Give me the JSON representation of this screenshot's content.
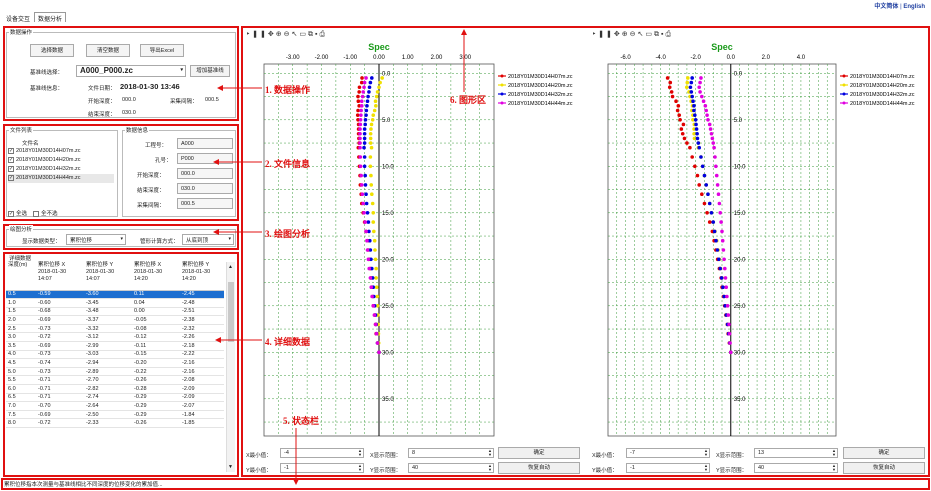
{
  "lang": {
    "zh": "中文简体",
    "sep": "|",
    "en": "English"
  },
  "tabs": [
    "设备交互",
    "数据分析"
  ],
  "data_ops": {
    "title": "数据操作",
    "btn_select": "选择数据",
    "btn_clear": "清空数据",
    "btn_export": "导出Excel",
    "baseline_label": "基准线选择：",
    "baseline_value": "A000_P000.zc",
    "btn_add_baseline": "增加基准线",
    "info_label": "基准线信息：",
    "file_date_label": "文件日期：",
    "file_date": "2018-01-30 13:46",
    "start_depth_label": "开始深度：",
    "start_depth": "000.0",
    "interval_label": "采集间隔：",
    "interval": "000.5",
    "end_depth_label": "结束深度：",
    "end_depth": "030.0"
  },
  "file_list": {
    "title": "文件列表",
    "header": "文件名",
    "files": [
      "2018Y01M30D14H07m.zc",
      "2018Y01M30D14H20m.zc",
      "2018Y01M30D14H32m.zc",
      "2018Y01M30D14H44m.zc"
    ],
    "select_all": "全选",
    "select_none": "全不选"
  },
  "data_info": {
    "title": "数据信息",
    "project_label": "工程号：",
    "project": "A000",
    "hole_label": "孔号：",
    "hole": "P000",
    "start_label": "开始深度：",
    "start": "000.0",
    "end_label": "结束深度：",
    "end": "030.0",
    "interval_label": "采集间隔：",
    "interval": "000.5"
  },
  "plot_analysis": {
    "title": "绘图分析",
    "display_label": "显示数据类型：",
    "display_value": "累积位移",
    "calc_label": "管形计算方式：",
    "calc_value": "从底到顶"
  },
  "detail": {
    "title": "详细数据",
    "headers": [
      "深度(m)",
      "累积位移 X\n2018-01-30\n14:07",
      "累积位移 Y\n2018-01-30\n14:07",
      "累积位移 X\n2018-01-30\n14:20",
      "累积位移 Y\n2018-01-30\n14:20"
    ],
    "rows": [
      [
        "0.5",
        "-0.59",
        "-3.60",
        "0.11",
        "-2.45"
      ],
      [
        "1.0",
        "-0.60",
        "-3.45",
        "0.04",
        "-2.48"
      ],
      [
        "1.5",
        "-0.68",
        "-3.48",
        "0.00",
        "-2.51"
      ],
      [
        "2.0",
        "-0.69",
        "-3.37",
        "-0.05",
        "-2.38"
      ],
      [
        "2.5",
        "-0.73",
        "-3.32",
        "-0.08",
        "-2.32"
      ],
      [
        "3.0",
        "-0.72",
        "-3.12",
        "-0.12",
        "-2.26"
      ],
      [
        "3.5",
        "-0.69",
        "-2.99",
        "-0.11",
        "-2.18"
      ],
      [
        "4.0",
        "-0.73",
        "-3.03",
        "-0.15",
        "-2.22"
      ],
      [
        "4.5",
        "-0.74",
        "-2.94",
        "-0.20",
        "-2.16"
      ],
      [
        "5.0",
        "-0.73",
        "-2.89",
        "-0.22",
        "-2.16"
      ],
      [
        "5.5",
        "-0.71",
        "-2.70",
        "-0.26",
        "-2.08"
      ],
      [
        "6.0",
        "-0.71",
        "-2.82",
        "-0.28",
        "-2.09"
      ],
      [
        "6.5",
        "-0.71",
        "-2.74",
        "-0.29",
        "-2.09"
      ],
      [
        "7.0",
        "-0.70",
        "-2.64",
        "-0.29",
        "-2.07"
      ],
      [
        "7.5",
        "-0.69",
        "-2.50",
        "-0.29",
        "-1.84"
      ],
      [
        "8.0",
        "-0.72",
        "-2.33",
        "-0.26",
        "-1.85"
      ]
    ]
  },
  "status": "累积位移指本次测量与基准线相比不同深度的位移变化的累加值...",
  "annotations": {
    "a1": "1. 数据操作",
    "a2": "2. 文件信息",
    "a3": "3. 绘图分析",
    "a4": "4. 详细数据",
    "a5": "5. 状态栏",
    "a6": "6. 图形区"
  },
  "controls_left": {
    "xmin_label": "X最小值：",
    "xmin": "-4",
    "xrange_label": "X显示范围：",
    "xrange": "8",
    "ymin_label": "Y最小值：",
    "ymin": "-1",
    "yrange_label": "Y显示范围：",
    "yrange": "40",
    "ok": "确定",
    "auto": "恢复自动"
  },
  "controls_right": {
    "xmin_label": "X最小值：",
    "xmin": "-7",
    "xrange_label": "X显示范围：",
    "xrange": "13",
    "ymin_label": "Y最小值：",
    "ymin": "-1",
    "yrange_label": "Y显示范围：",
    "yrange": "40",
    "ok": "确定",
    "auto": "恢复自动"
  },
  "toolbar_icons": [
    "pause-icon",
    "pan-icon",
    "zoom-in-icon",
    "zoom-out-icon",
    "cursor-icon",
    "select-icon",
    "copy-icon",
    "save-icon",
    "print-icon",
    "preview-icon"
  ],
  "chart_data": [
    {
      "type": "scatter",
      "title": "Spec",
      "xlim": [
        -4,
        4
      ],
      "ylim": [
        -1,
        39
      ],
      "y_inverted": true,
      "x_ticks": [
        -3,
        -2,
        -1,
        0,
        1,
        2,
        3
      ],
      "x_tick_labels": [
        "-3.00",
        "-2.00",
        "-1.00",
        "0.00",
        "1.00",
        "2.00",
        "3.00"
      ],
      "y_ticks": [
        0,
        5,
        10,
        15,
        20,
        25,
        30,
        35
      ],
      "y_tick_labels": [
        "0.0",
        "5.0",
        "10.0",
        "15.0",
        "20.0",
        "25.0",
        "30.0",
        "35.0"
      ],
      "grid": true,
      "legend": "right",
      "series": [
        {
          "name": "2018Y01M30D14H07m.zc",
          "color": "#e00000",
          "depth": [
            0.5,
            1,
            1.5,
            2,
            2.5,
            3,
            3.5,
            4,
            4.5,
            5,
            5.5,
            6,
            6.5,
            7,
            7.5,
            8,
            9,
            10,
            11,
            12,
            13,
            14,
            15,
            16,
            17,
            18,
            19,
            20,
            21,
            22,
            23,
            24,
            25,
            26,
            27,
            28,
            29,
            30
          ],
          "x": [
            -0.59,
            -0.6,
            -0.68,
            -0.69,
            -0.73,
            -0.72,
            -0.69,
            -0.73,
            -0.74,
            -0.73,
            -0.71,
            -0.71,
            -0.71,
            -0.7,
            -0.69,
            -0.72,
            -0.7,
            -0.68,
            -0.66,
            -0.65,
            -0.62,
            -0.6,
            -0.55,
            -0.5,
            -0.45,
            -0.4,
            -0.38,
            -0.35,
            -0.3,
            -0.28,
            -0.25,
            -0.22,
            -0.2,
            -0.15,
            -0.12,
            -0.1,
            -0.05,
            0
          ]
        },
        {
          "name": "2018Y01M30D14H20m.zc",
          "color": "#f0e000",
          "depth": [
            0.5,
            1,
            1.5,
            2,
            2.5,
            3,
            3.5,
            4,
            4.5,
            5,
            5.5,
            6,
            6.5,
            7,
            7.5,
            8,
            9,
            10,
            11,
            12,
            13,
            14,
            15,
            16,
            17,
            18,
            19,
            20,
            21,
            22,
            23,
            24,
            25,
            26,
            27,
            28,
            29,
            30
          ],
          "x": [
            0.11,
            0.04,
            0,
            -0.05,
            -0.08,
            -0.12,
            -0.11,
            -0.15,
            -0.2,
            -0.22,
            -0.26,
            -0.28,
            -0.29,
            -0.29,
            -0.29,
            -0.26,
            -0.3,
            -0.3,
            -0.28,
            -0.27,
            -0.25,
            -0.22,
            -0.2,
            -0.2,
            -0.18,
            -0.15,
            -0.14,
            -0.12,
            -0.1,
            -0.1,
            -0.08,
            -0.06,
            -0.05,
            -0.04,
            -0.03,
            -0.02,
            -0.01,
            0
          ]
        },
        {
          "name": "2018Y01M30D14H32m.zc",
          "color": "#0000e0",
          "depth": [
            0.5,
            1,
            1.5,
            2,
            2.5,
            3,
            3.5,
            4,
            4.5,
            5,
            5.5,
            6,
            6.5,
            7,
            7.5,
            8,
            9,
            10,
            11,
            12,
            13,
            14,
            15,
            16,
            17,
            18,
            19,
            20,
            21,
            22,
            23,
            24,
            25,
            26,
            27,
            28,
            29,
            30
          ],
          "x": [
            -0.25,
            -0.3,
            -0.33,
            -0.35,
            -0.38,
            -0.4,
            -0.42,
            -0.44,
            -0.45,
            -0.47,
            -0.48,
            -0.5,
            -0.5,
            -0.5,
            -0.5,
            -0.52,
            -0.5,
            -0.5,
            -0.48,
            -0.47,
            -0.45,
            -0.43,
            -0.4,
            -0.37,
            -0.35,
            -0.32,
            -0.3,
            -0.28,
            -0.25,
            -0.22,
            -0.2,
            -0.18,
            -0.15,
            -0.12,
            -0.1,
            -0.08,
            -0.05,
            0
          ]
        },
        {
          "name": "2018Y01M30D14H44m.zc",
          "color": "#e000e0",
          "depth": [
            0.5,
            1,
            1.5,
            2,
            2.5,
            3,
            3.5,
            4,
            4.5,
            5,
            5.5,
            6,
            6.5,
            7,
            7.5,
            8,
            9,
            10,
            11,
            12,
            13,
            14,
            15,
            16,
            17,
            18,
            19,
            20,
            21,
            22,
            23,
            24,
            25,
            26,
            27,
            28,
            29,
            30
          ],
          "x": [
            -0.45,
            -0.5,
            -0.52,
            -0.55,
            -0.57,
            -0.6,
            -0.6,
            -0.62,
            -0.63,
            -0.64,
            -0.65,
            -0.66,
            -0.66,
            -0.66,
            -0.66,
            -0.66,
            -0.65,
            -0.64,
            -0.62,
            -0.6,
            -0.58,
            -0.55,
            -0.52,
            -0.48,
            -0.45,
            -0.42,
            -0.4,
            -0.37,
            -0.34,
            -0.3,
            -0.27,
            -0.24,
            -0.2,
            -0.16,
            -0.12,
            -0.09,
            -0.05,
            0
          ]
        }
      ]
    },
    {
      "type": "scatter",
      "title": "Spec",
      "xlim": [
        -7,
        6
      ],
      "ylim": [
        -1,
        39
      ],
      "y_inverted": true,
      "x_ticks": [
        -6,
        -4,
        -2,
        0,
        2,
        4
      ],
      "x_tick_labels": [
        "-6.0",
        "-4.0",
        "-2.0",
        "0.0",
        "2.0",
        "4.0"
      ],
      "y_ticks": [
        0,
        5,
        10,
        15,
        20,
        25,
        30,
        35
      ],
      "y_tick_labels": [
        "0.0",
        "5.0",
        "10.0",
        "15.0",
        "20.0",
        "25.0",
        "30.0",
        "35.0"
      ],
      "grid": true,
      "legend": "right",
      "series": [
        {
          "name": "2018Y01M30D14H07m.zc",
          "color": "#e00000",
          "depth": [
            0.5,
            1,
            1.5,
            2,
            2.5,
            3,
            3.5,
            4,
            4.5,
            5,
            5.5,
            6,
            6.5,
            7,
            7.5,
            8,
            9,
            10,
            11,
            12,
            13,
            14,
            15,
            16,
            17,
            18,
            19,
            20,
            21,
            22,
            23,
            24,
            25,
            26,
            27,
            28,
            29,
            30
          ],
          "x": [
            -3.6,
            -3.45,
            -3.48,
            -3.37,
            -3.32,
            -3.12,
            -2.99,
            -3.03,
            -2.94,
            -2.89,
            -2.7,
            -2.82,
            -2.74,
            -2.64,
            -2.5,
            -2.33,
            -2.2,
            -2.05,
            -1.9,
            -1.8,
            -1.65,
            -1.5,
            -1.35,
            -1.2,
            -1.05,
            -0.95,
            -0.85,
            -0.75,
            -0.65,
            -0.55,
            -0.5,
            -0.42,
            -0.35,
            -0.28,
            -0.2,
            -0.15,
            -0.08,
            0
          ]
        },
        {
          "name": "2018Y01M30D14H20m.zc",
          "color": "#f0e000",
          "depth": [
            0.5,
            1,
            1.5,
            2,
            2.5,
            3,
            3.5,
            4,
            4.5,
            5,
            5.5,
            6,
            6.5,
            7,
            7.5,
            8,
            9,
            10,
            11,
            12,
            13,
            14,
            15,
            16,
            17,
            18,
            19,
            20,
            21,
            22,
            23,
            24,
            25,
            26,
            27,
            28,
            29,
            30
          ],
          "x": [
            -2.45,
            -2.48,
            -2.51,
            -2.38,
            -2.32,
            -2.26,
            -2.18,
            -2.22,
            -2.16,
            -2.16,
            -2.08,
            -2.09,
            -2.09,
            -2.07,
            -1.84,
            -1.85,
            -1.7,
            -1.6,
            -1.5,
            -1.4,
            -1.3,
            -1.2,
            -1.1,
            -1,
            -0.9,
            -0.8,
            -0.72,
            -0.65,
            -0.58,
            -0.5,
            -0.44,
            -0.38,
            -0.3,
            -0.25,
            -0.18,
            -0.12,
            -0.06,
            0
          ]
        },
        {
          "name": "2018Y01M30D14H32m.zc",
          "color": "#0000e0",
          "depth": [
            0.5,
            1,
            1.5,
            2,
            2.5,
            3,
            3.5,
            4,
            4.5,
            5,
            5.5,
            6,
            6.5,
            7,
            7.5,
            8,
            9,
            10,
            11,
            12,
            13,
            14,
            15,
            16,
            17,
            18,
            19,
            20,
            21,
            22,
            23,
            24,
            25,
            26,
            27,
            28,
            29,
            30
          ],
          "x": [
            -2.2,
            -2.25,
            -2.3,
            -2.25,
            -2.2,
            -2.15,
            -2.1,
            -2.1,
            -2.05,
            -2,
            -1.98,
            -1.95,
            -1.92,
            -1.9,
            -1.85,
            -1.8,
            -1.7,
            -1.6,
            -1.5,
            -1.4,
            -1.3,
            -1.2,
            -1.1,
            -1,
            -0.92,
            -0.84,
            -0.76,
            -0.68,
            -0.6,
            -0.52,
            -0.45,
            -0.38,
            -0.32,
            -0.25,
            -0.18,
            -0.12,
            -0.06,
            0
          ]
        },
        {
          "name": "2018Y01M30D14H44m.zc",
          "color": "#e000e0",
          "depth": [
            0.5,
            1,
            1.5,
            2,
            2.5,
            3,
            3.5,
            4,
            4.5,
            5,
            5.5,
            6,
            6.5,
            7,
            7.5,
            8,
            9,
            10,
            11,
            12,
            13,
            14,
            15,
            16,
            17,
            18,
            19,
            20,
            21,
            22,
            23,
            24,
            25,
            26,
            27,
            28,
            29,
            30
          ],
          "x": [
            -1.7,
            -1.75,
            -1.8,
            -1.75,
            -1.65,
            -1.55,
            -1.45,
            -1.4,
            -1.35,
            -1.3,
            -1.2,
            -1.15,
            -1.1,
            -1.05,
            -1,
            -0.95,
            -0.9,
            -0.85,
            -0.8,
            -0.75,
            -0.7,
            -0.65,
            -0.6,
            -0.55,
            -0.5,
            -0.46,
            -0.42,
            -0.38,
            -0.34,
            -0.3,
            -0.26,
            -0.22,
            -0.18,
            -0.14,
            -0.1,
            -0.07,
            -0.04,
            0
          ]
        }
      ]
    }
  ]
}
